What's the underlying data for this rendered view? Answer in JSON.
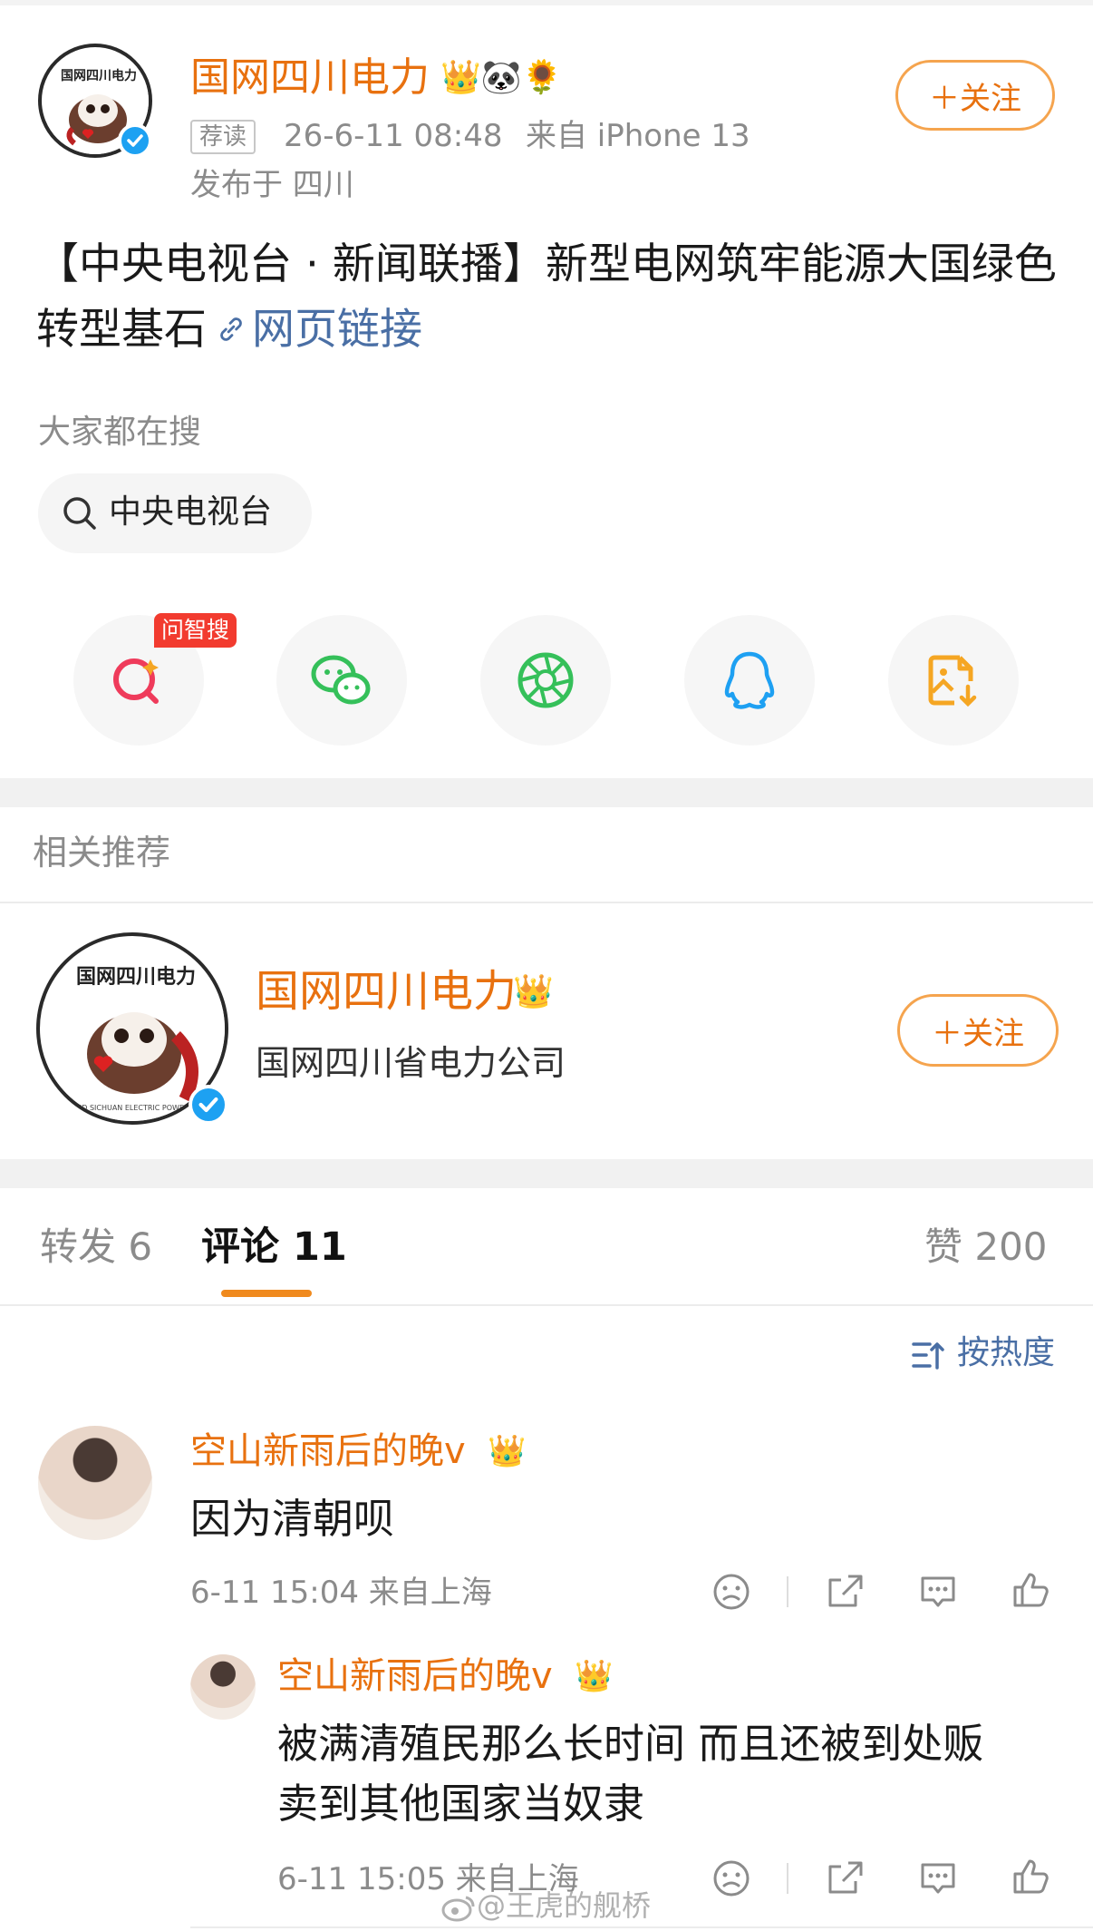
{
  "post": {
    "author": "国网四川电力",
    "author_emojis": "👑🐼🌻",
    "tag": "荐读",
    "time": "26-6-11 08:48",
    "source": "来自 iPhone 13",
    "location": "发布于 四川",
    "follow_label": "＋关注",
    "text": "【中央电视台 · 新闻联播】新型电网筑牢能源大国绿色转型基石",
    "link_label": "网页链接"
  },
  "search": {
    "heading": "大家都在搜",
    "chip_label": "中央电视台"
  },
  "share": {
    "badge": "问智搜",
    "icons": [
      "ai-search-icon",
      "wechat-icon",
      "moments-icon",
      "qq-icon",
      "save-image-icon"
    ]
  },
  "related": {
    "heading": "相关推荐",
    "name": "国网四川电力",
    "crown": "👑",
    "desc": "国网四川省电力公司",
    "follow_label": "＋关注"
  },
  "tabs": {
    "repost": "转发 6",
    "comment": "评论 11",
    "like": "赞 200",
    "sort": "按热度"
  },
  "comments": [
    {
      "user": "空山新雨后的晚v",
      "crown": "👑",
      "text": "因为清朝呗",
      "meta": "6-11 15:04 来自上海"
    },
    {
      "user": "空山新雨后的晚v",
      "crown": "👑",
      "text_line1": "被满清殖民那么长时间 而且还被到处贩",
      "text_line2": "卖到其他国家当奴隶",
      "meta": "6-11 15:05 来自上海"
    }
  ],
  "watermark": "@王虎的舰桥",
  "colors": {
    "accent": "#e8710f",
    "link": "#4a6fa5",
    "verified": "#1da1f2",
    "badge_red": "#f23b2f"
  }
}
